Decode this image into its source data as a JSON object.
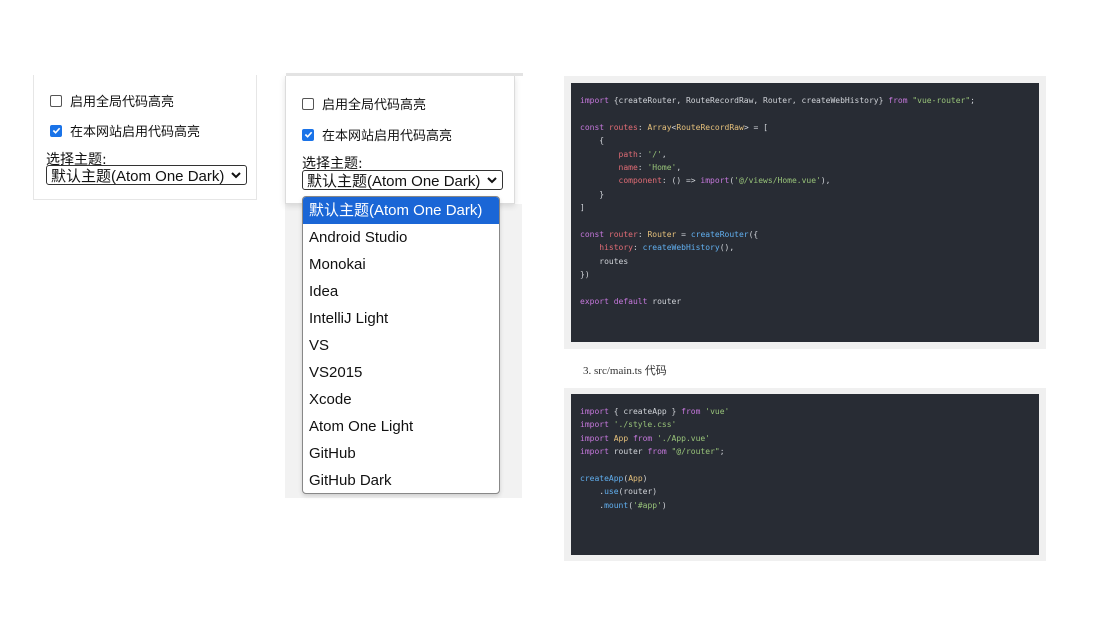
{
  "panel1": {
    "option_global": "启用全局代码高亮",
    "option_site": "在本网站启用代码高亮",
    "global_checked": false,
    "site_checked": true,
    "theme_label": "选择主题:",
    "theme_value": "默认主题(Atom One Dark)"
  },
  "panel2": {
    "option_global": "启用全局代码高亮",
    "option_site": "在本网站启用代码高亮",
    "global_checked": false,
    "site_checked": true,
    "theme_label": "选择主题:",
    "theme_value": "默认主题(Atom One Dark)"
  },
  "theme_options": [
    "默认主题(Atom One Dark)",
    "Android Studio",
    "Monokai",
    "Idea",
    "IntelliJ Light",
    "VS",
    "VS2015",
    "Xcode",
    "Atom One Light",
    "GitHub",
    "GitHub Dark"
  ],
  "selected_theme_index": 0,
  "caption": "3. src/main.ts 代码",
  "code1": [
    [
      [
        "kw",
        "import "
      ],
      [
        "pl",
        "{createRouter, RouteRecordRaw, Router, createWebHistory} "
      ],
      [
        "kw",
        "from "
      ],
      [
        "str",
        "\"vue-router\""
      ],
      [
        "pl",
        ";"
      ]
    ],
    [],
    [
      [
        "kw",
        "const "
      ],
      [
        "var",
        "routes"
      ],
      [
        "pl",
        ": "
      ],
      [
        "ty",
        "Array"
      ],
      [
        "pl",
        "<"
      ],
      [
        "ty",
        "RouteRecordRaw"
      ],
      [
        "pl",
        "> = ["
      ]
    ],
    [
      [
        "pl",
        "    {"
      ]
    ],
    [
      [
        "pl",
        "        "
      ],
      [
        "var",
        "path"
      ],
      [
        "pl",
        ": "
      ],
      [
        "str",
        "'/'"
      ],
      [
        "pl",
        ","
      ]
    ],
    [
      [
        "pl",
        "        "
      ],
      [
        "var",
        "name"
      ],
      [
        "pl",
        ": "
      ],
      [
        "str",
        "'Home'"
      ],
      [
        "pl",
        ","
      ]
    ],
    [
      [
        "pl",
        "        "
      ],
      [
        "var",
        "component"
      ],
      [
        "pl",
        ": () => "
      ],
      [
        "kw",
        "import"
      ],
      [
        "pl",
        "("
      ],
      [
        "str",
        "'@/views/Home.vue'"
      ],
      [
        "pl",
        "),"
      ]
    ],
    [
      [
        "pl",
        "    }"
      ]
    ],
    [
      [
        "pl",
        "]"
      ]
    ],
    [],
    [
      [
        "kw",
        "const "
      ],
      [
        "var",
        "router"
      ],
      [
        "pl",
        ": "
      ],
      [
        "ty",
        "Router"
      ],
      [
        "pl",
        " = "
      ],
      [
        "fn",
        "createRouter"
      ],
      [
        "pl",
        "({"
      ]
    ],
    [
      [
        "pl",
        "    "
      ],
      [
        "var",
        "history"
      ],
      [
        "pl",
        ": "
      ],
      [
        "fn",
        "createWebHistory"
      ],
      [
        "pl",
        "(),"
      ]
    ],
    [
      [
        "pl",
        "    routes"
      ]
    ],
    [
      [
        "pl",
        "})"
      ]
    ],
    [],
    [
      [
        "kw",
        "export default "
      ],
      [
        "pl",
        "router"
      ]
    ]
  ],
  "code2": [
    [
      [
        "kw",
        "import "
      ],
      [
        "pl",
        "{ createApp } "
      ],
      [
        "kw",
        "from "
      ],
      [
        "str",
        "'vue'"
      ]
    ],
    [
      [
        "kw",
        "import "
      ],
      [
        "str",
        "'./style.css'"
      ]
    ],
    [
      [
        "kw",
        "import "
      ],
      [
        "ty",
        "App "
      ],
      [
        "kw",
        "from "
      ],
      [
        "str",
        "'./App.vue'"
      ]
    ],
    [
      [
        "kw",
        "import "
      ],
      [
        "pl",
        "router "
      ],
      [
        "kw",
        "from "
      ],
      [
        "str",
        "\"@/router\""
      ],
      [
        "pl",
        ";"
      ]
    ],
    [],
    [
      [
        "fn",
        "createApp"
      ],
      [
        "pl",
        "("
      ],
      [
        "ty",
        "App"
      ],
      [
        "pl",
        ")"
      ]
    ],
    [
      [
        "pl",
        "    ."
      ],
      [
        "fn",
        "use"
      ],
      [
        "pl",
        "(router)"
      ]
    ],
    [
      [
        "pl",
        "    ."
      ],
      [
        "fn",
        "mount"
      ],
      [
        "pl",
        "("
      ],
      [
        "str",
        "'#app'"
      ],
      [
        "pl",
        ")"
      ]
    ]
  ],
  "colors": {
    "accent": "#1a66d6",
    "code_bg": "#282c34",
    "keyword": "#c678dd",
    "string": "#98c379",
    "function": "#61afef",
    "type": "#e5c07b",
    "variable": "#e06c75"
  }
}
